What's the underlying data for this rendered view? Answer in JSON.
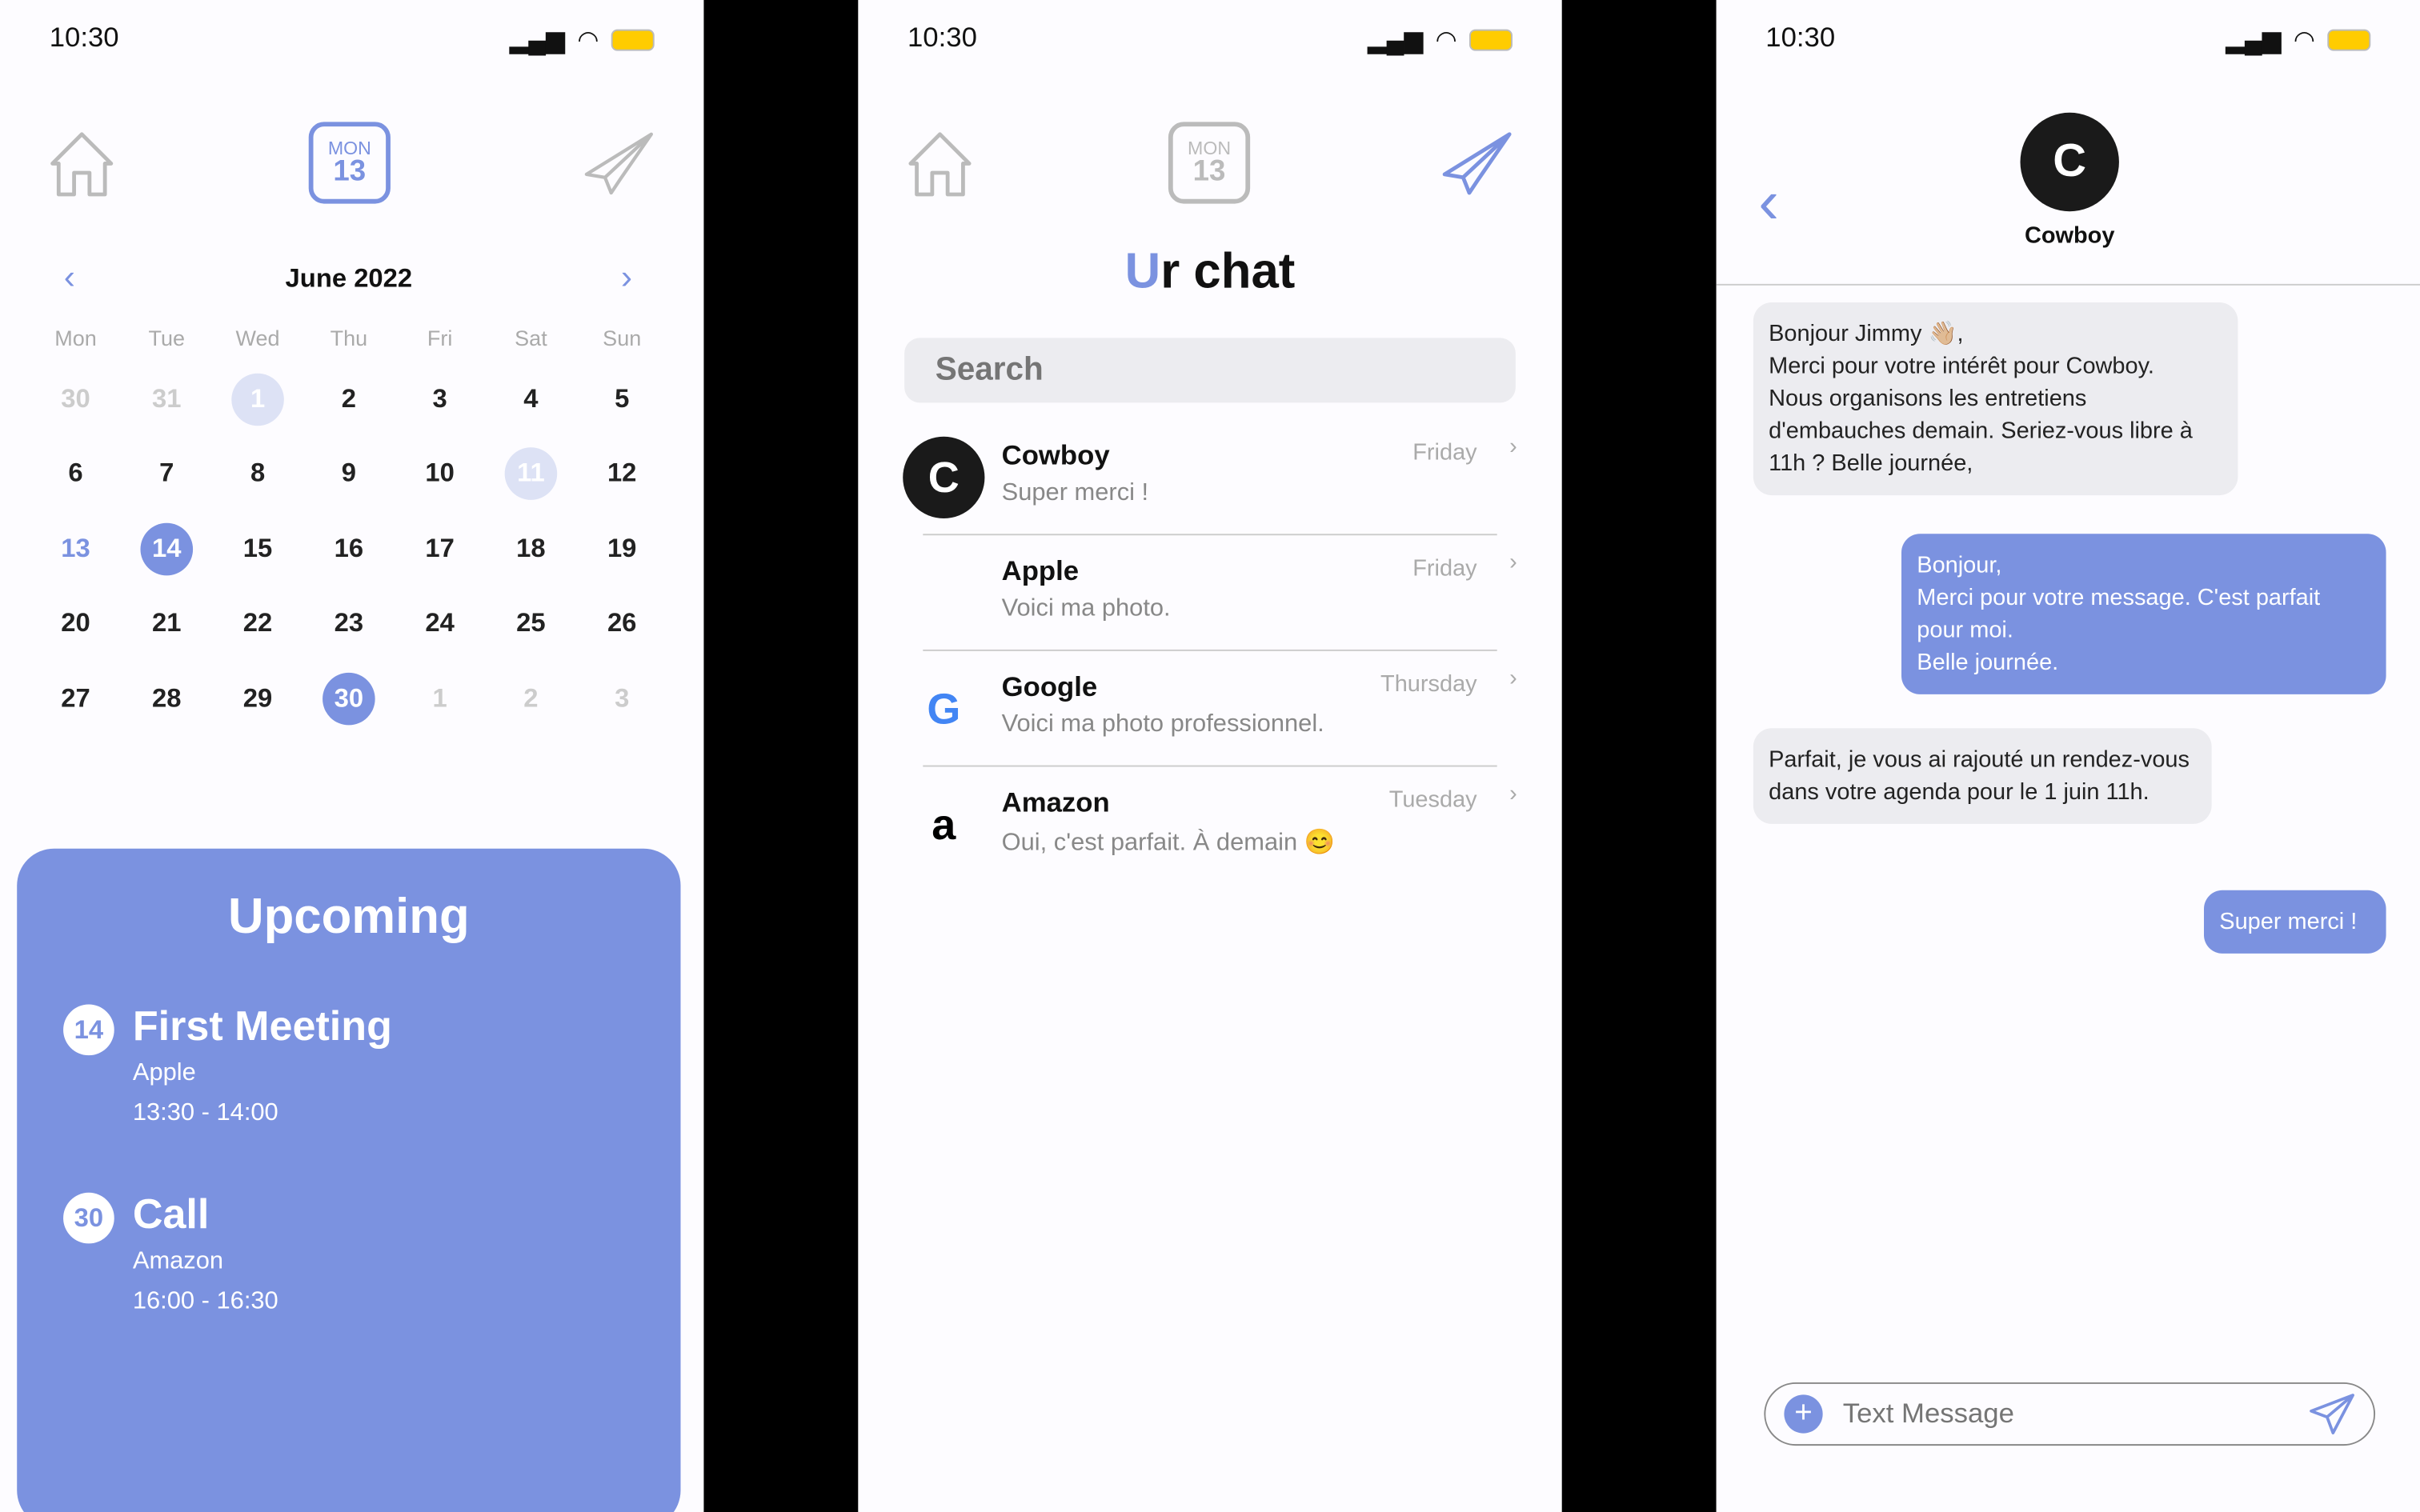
{
  "status": {
    "time": "10:30"
  },
  "nav": {
    "cal_day": "MON",
    "cal_date": "13"
  },
  "calendar": {
    "month": "June 2022",
    "weekdays": [
      "Mon",
      "Tue",
      "Wed",
      "Thu",
      "Fri",
      "Sat",
      "Sun"
    ],
    "weeks": [
      [
        "30",
        "31",
        "1",
        "2",
        "3",
        "4",
        "5"
      ],
      [
        "6",
        "7",
        "8",
        "9",
        "10",
        "11",
        "12"
      ],
      [
        "13",
        "14",
        "15",
        "16",
        "17",
        "18",
        "19"
      ],
      [
        "20",
        "21",
        "22",
        "23",
        "24",
        "25",
        "26"
      ],
      [
        "27",
        "28",
        "29",
        "30",
        "1",
        "2",
        "3"
      ]
    ]
  },
  "upcoming": {
    "title": "Upcoming",
    "events": [
      {
        "day": "14",
        "title": "First Meeting",
        "company": "Apple",
        "time": "13:30 - 14:00"
      },
      {
        "day": "30",
        "title": "Call",
        "company": "Amazon",
        "time": "16:00 - 16:30"
      }
    ]
  },
  "chats": {
    "title_accent": "U",
    "title_rest": "r chat",
    "search_placeholder": "Search",
    "items": [
      {
        "name": "Cowboy",
        "message": "Super merci !",
        "day": "Friday"
      },
      {
        "name": "Apple",
        "message": "Voici ma photo.",
        "day": "Friday"
      },
      {
        "name": "Google",
        "message": "Voici ma photo professionnel.",
        "day": "Thursday"
      },
      {
        "name": "Amazon",
        "message": "Oui, c'est parfait. À demain 😊",
        "day": "Tuesday"
      }
    ]
  },
  "conversation": {
    "contact": "Cowboy",
    "messages": [
      {
        "from": "them",
        "text": "Bonjour Jimmy 👋🏼,\nMerci pour votre intérêt pour Cowboy.\nNous organisons les entretiens d'embauches demain. Seriez-vous libre à 11h ? Belle journée,"
      },
      {
        "from": "me",
        "text": "Bonjour,\nMerci pour votre message. C'est parfait pour moi.\nBelle journée."
      },
      {
        "from": "them",
        "text": "Parfait, je vous ai rajouté un rendez-vous dans votre agenda pour le 1 juin 11h."
      },
      {
        "from": "me",
        "text": "Super merci !"
      }
    ],
    "input_placeholder": "Text Message"
  },
  "colors": {
    "accent": "#7b92e0",
    "bubble_received": "#ececf0"
  }
}
